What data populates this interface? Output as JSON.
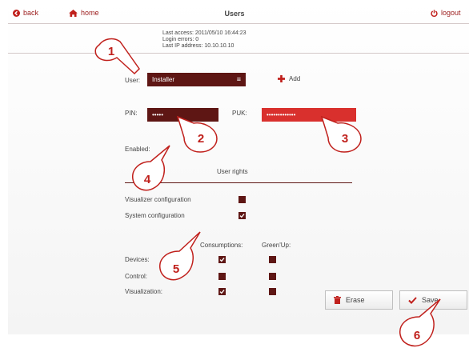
{
  "topbar": {
    "back_label": "back",
    "home_label": "home",
    "title": "Users",
    "logout_label": "logout"
  },
  "access": {
    "last_access": "Last access: 2011/05/10 16:44:23",
    "login_errors": "Login errors: 0",
    "last_ip": "Last IP address: 10.10.10.10"
  },
  "user": {
    "label": "User:",
    "value": "Installer",
    "add_label": "Add"
  },
  "pin": {
    "label": "PIN:",
    "value": "•••••"
  },
  "puk": {
    "label": "PUK:",
    "value": "•••••••••••••"
  },
  "enabled": {
    "label": "Enabled:"
  },
  "rights": {
    "title": "User rights",
    "items": [
      {
        "label": "Visualizer configuration",
        "checked": false
      },
      {
        "label": "System configuration",
        "checked": true
      }
    ],
    "col_consumptions": "Consumptions:",
    "col_greenup": "Green'Up:",
    "rows": [
      {
        "label": "Devices:",
        "consumptions": true,
        "greenup": false
      },
      {
        "label": "Control:",
        "consumptions": false,
        "greenup": false
      },
      {
        "label": "Visualization:",
        "consumptions": true,
        "greenup": false
      }
    ]
  },
  "actions": {
    "erase_label": "Erase",
    "save_label": "Save"
  },
  "callouts": [
    "1",
    "2",
    "3",
    "4",
    "5",
    "6"
  ],
  "colors": {
    "accent_red": "#d9302d",
    "dark_red": "#5e1614",
    "icon_red": "#9b1b1b"
  }
}
